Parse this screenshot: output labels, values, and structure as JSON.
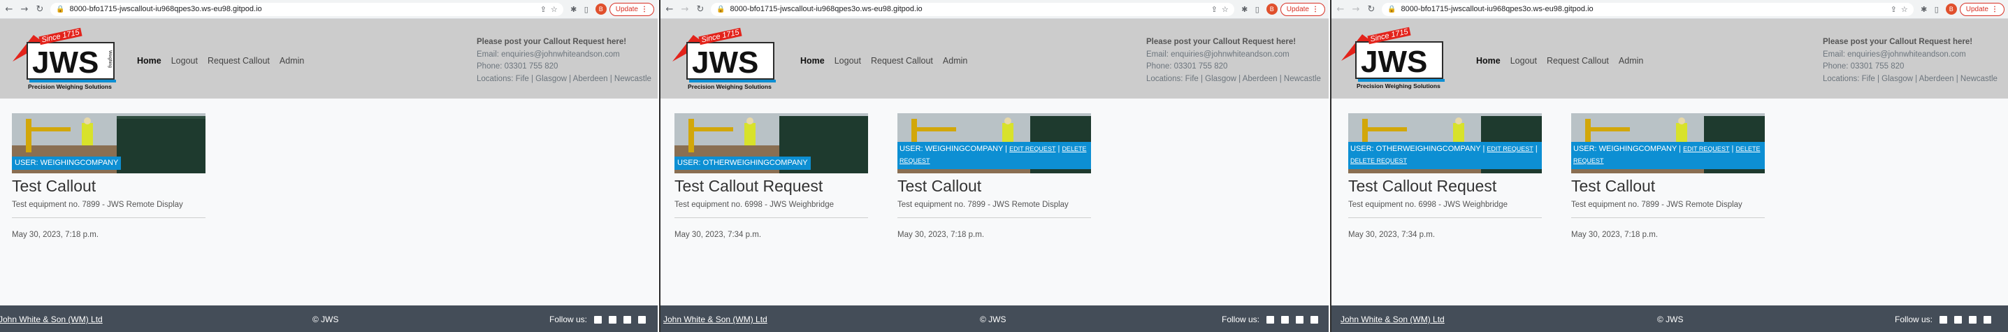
{
  "browser": {
    "url": "8000-bfo1715-jwscallout-iu968qpes3o.ws-eu98.gitpod.io",
    "avatar_letter": "B",
    "update_label": "Update",
    "icons": [
      "back-icon",
      "forward-icon",
      "reload-icon",
      "lock-icon",
      "share-icon",
      "star-icon",
      "extensions-icon",
      "sidebar-icon",
      "menu-icon"
    ]
  },
  "site": {
    "logo_since": "Since 1715",
    "logo_text": "JWS",
    "logo_tagline": "Precision Weighing Solutions",
    "nav": [
      {
        "label": "Home"
      },
      {
        "label": "Logout"
      },
      {
        "label": "Request Callout"
      },
      {
        "label": "Admin"
      }
    ],
    "contact": {
      "heading": "Please post your Callout Request here!",
      "email": "Email: enquiries@johnwhiteandson.com",
      "phone": "Phone: 03301 755 820",
      "locations": "Locations: Fife | Glasgow | Aberdeen | Newcastle"
    }
  },
  "cards": {
    "c0_user": "USER: WEIGHINGCOMPANY",
    "c0_title": "Test Callout",
    "c0_equipment": "Test equipment no. 7899 - JWS Remote Display",
    "c0_date": "May 30, 2023, 7:18 p.m.",
    "c1_user": "USER: OTHERWEIGHINGCOMPANY",
    "c1_title": "Test Callout Request",
    "c1_equipment": "Test equipment no. 6998 - JWS Weighbridge",
    "c1_date": "May 30, 2023, 7:34 p.m.",
    "c2_user": "USER: WEIGHINGCOMPANY",
    "c2_edit": "EDIT REQUEST",
    "c2_delete": "DELETE REQUEST",
    "c2_title": "Test Callout",
    "c2_equipment": "Test equipment no. 7899 - JWS Remote Display",
    "c2_date": "May 30, 2023, 7:18 p.m.",
    "c3_user": "USER: OTHERWEIGHINGCOMPANY",
    "c3_edit": "EDIT REQUEST",
    "c3_delete": "DELETE REQUEST",
    "c3_title": "Test Callout Request",
    "c3_equipment": "Test equipment no. 6998 - JWS Weighbridge",
    "c3_date": "May 30, 2023, 7:34 p.m.",
    "c4_user": "USER: WEIGHINGCOMPANY",
    "c4_edit": "EDIT REQUEST",
    "c4_delete": "DELETE REQUEST",
    "c4_title": "Test Callout",
    "c4_equipment": "Test equipment no. 7899 - JWS Remote Display",
    "c4_date": "May 30, 2023, 7:18 p.m."
  },
  "footer": {
    "company": "John White & Son (WM) Ltd",
    "copyright": "© JWS",
    "follow": "Follow us:",
    "social_icons": [
      "linkedin-icon",
      "twitter-icon",
      "instagram-icon",
      "facebook-icon"
    ]
  },
  "colors": {
    "header_bg": "#cccccc",
    "footer_bg": "#444d58",
    "user_tag": "#0d8fd3",
    "logo_red": "#e3231b",
    "update_red": "#d93025"
  }
}
